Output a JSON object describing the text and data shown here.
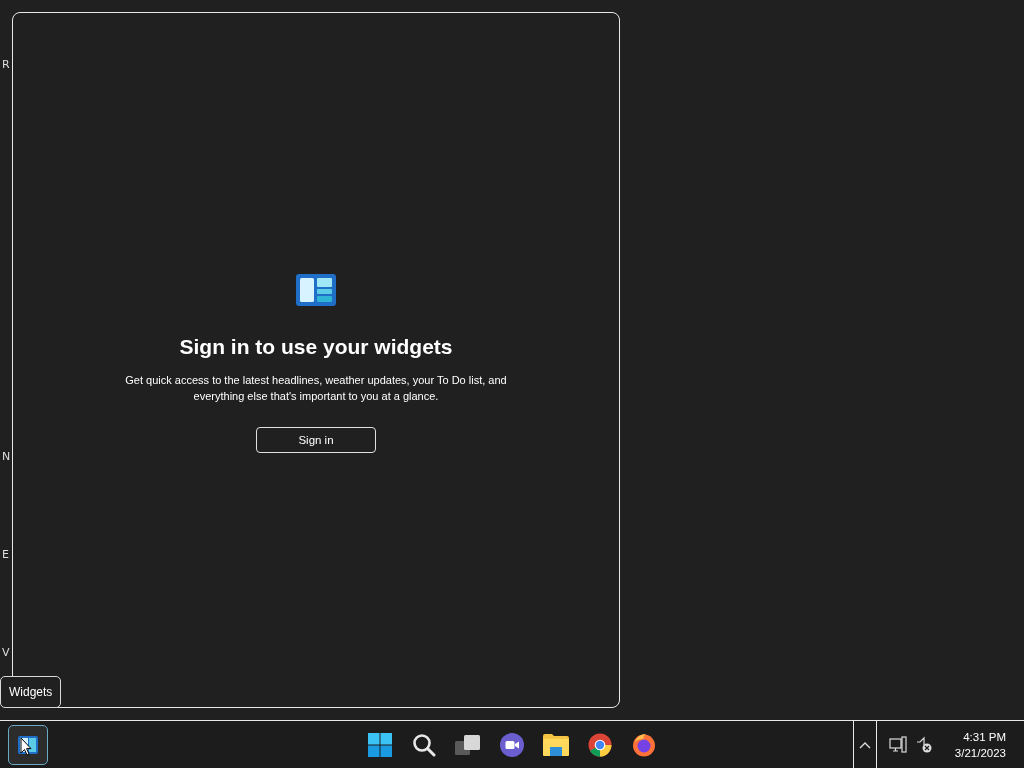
{
  "desktop": {
    "icon_labels": [
      "R",
      "N",
      "E",
      "V"
    ]
  },
  "widgets_panel": {
    "title": "Sign in to use your widgets",
    "description": "Get quick access to the latest headlines, weather updates, your To Do list, and everything else that's important to you at a glance.",
    "button": "Sign in"
  },
  "tooltip": "Widgets",
  "taskbar": {
    "widgets_button": {
      "selected": true
    },
    "apps": [
      {
        "kind": "start"
      },
      {
        "kind": "search"
      },
      {
        "kind": "taskview"
      },
      {
        "kind": "chat"
      },
      {
        "kind": "explorer"
      },
      {
        "kind": "chrome"
      },
      {
        "kind": "firefox"
      }
    ],
    "clock": {
      "time": "4:31 PM",
      "date": "3/21/2023"
    }
  }
}
